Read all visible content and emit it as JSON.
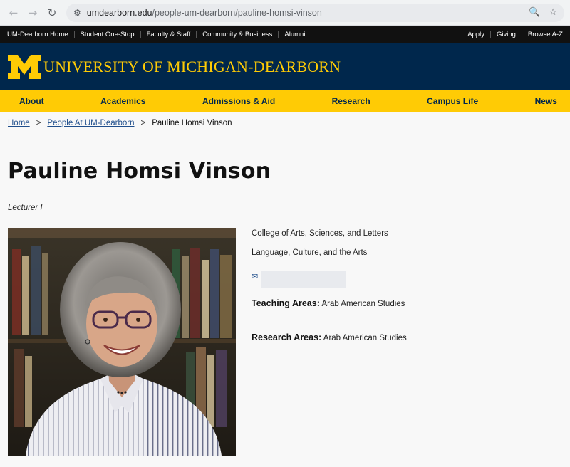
{
  "browser": {
    "url_host": "umdearborn.edu",
    "url_path": "/people-um-dearborn/pauline-homsi-vinson"
  },
  "utility_nav": {
    "left": [
      "UM-Dearborn Home",
      "Student One-Stop",
      "Faculty & Staff",
      "Community & Business",
      "Alumni"
    ],
    "right": [
      "Apply",
      "Giving",
      "Browse A-Z"
    ]
  },
  "header": {
    "wordmark": "UNIVERSITY OF MICHIGAN-DEARBORN",
    "brand_blue": "#00274c",
    "brand_maize": "#ffcb05"
  },
  "main_nav": [
    "About",
    "Academics",
    "Admissions & Aid",
    "Research",
    "Campus Life",
    "News"
  ],
  "breadcrumb": {
    "home": "Home",
    "sep": ">",
    "parent": "People At UM-Dearborn",
    "current": "Pauline Homsi Vinson"
  },
  "profile": {
    "name": "Pauline Homsi Vinson",
    "title": "Lecturer I",
    "college": "College of Arts, Sciences, and Letters",
    "department": "Language, Culture, and the Arts",
    "teaching_label": "Teaching Areas:",
    "teaching_value": "Arab American Studies",
    "research_label": "Research Areas:",
    "research_value": "Arab American Studies"
  }
}
